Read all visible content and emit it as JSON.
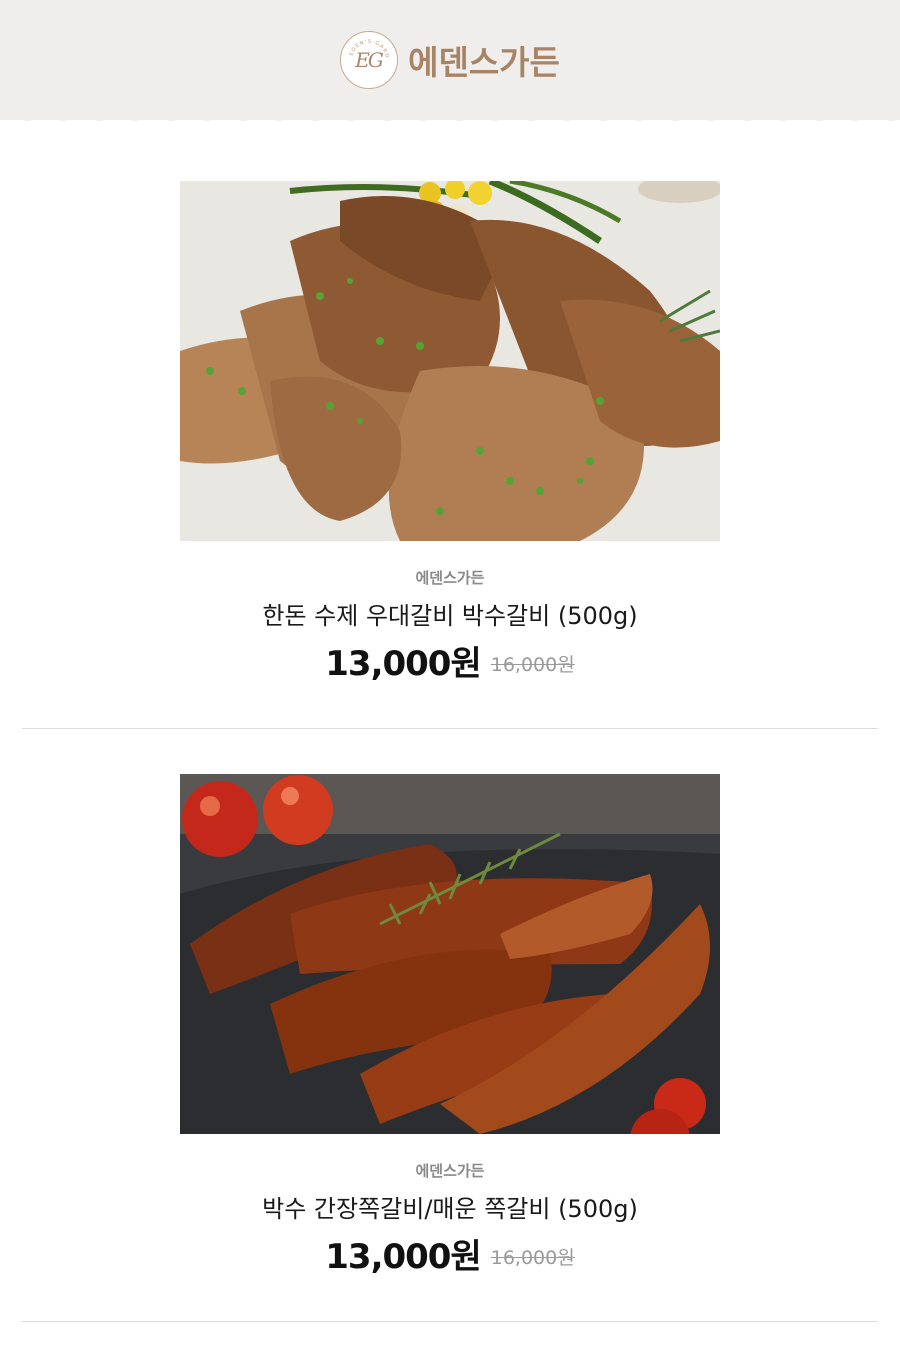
{
  "header": {
    "logo_letters": "EG",
    "logo_arc_text": "EDEN'S GARDEN",
    "brand_name": "에덴스가든"
  },
  "products": [
    {
      "brand": "에덴스가든",
      "name": "한돈 수제 우대갈비 박수갈비 (500g)",
      "sale_price": "13,000원",
      "original_price": "16,000원"
    },
    {
      "brand": "에덴스가든",
      "name": "박수 간장쪽갈비/매운 쪽갈비 (500g)",
      "sale_price": "13,000원",
      "original_price": "16,000원"
    }
  ],
  "colors": {
    "header_bg": "#efeeec",
    "brand_accent": "#a88466",
    "price": "#111111",
    "strikethrough_price": "#9a9a9a"
  }
}
